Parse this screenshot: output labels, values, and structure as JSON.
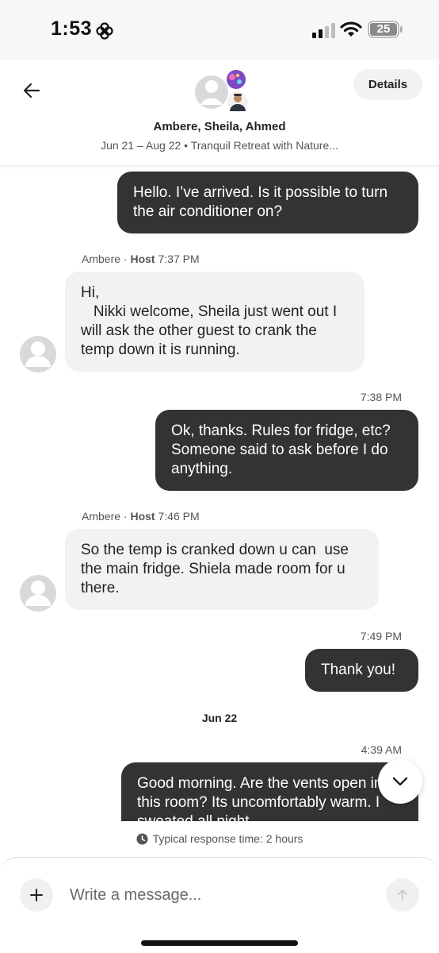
{
  "status_bar": {
    "time": "1:53",
    "battery": "25",
    "icons": [
      "focus-icon",
      "cellular-signal-icon",
      "wifi-icon",
      "battery-icon"
    ]
  },
  "header": {
    "participants": "Ambere, Sheila, Ahmed",
    "trip_info": "Jun 21 – Aug 22 • Tranquil Retreat with Nature...",
    "details_label": "Details",
    "icons": [
      "back-arrow-icon",
      "group-avatar"
    ]
  },
  "messages": [
    {
      "direction": "out",
      "text": "Hello. I’ve arrived. Is it possible to turn the air conditioner on?"
    },
    {
      "sender": "Ambere",
      "role": "Host",
      "time": "7:37 PM"
    },
    {
      "direction": "in",
      "text": "Hi,\n   Nikki welcome, Sheila just went out I will ask the other guest to crank the temp down it is running."
    },
    {
      "time": "7:38 PM"
    },
    {
      "direction": "out",
      "text": "Ok, thanks. Rules for fridge, etc? Someone said to ask before I do anything."
    },
    {
      "sender": "Ambere",
      "role": "Host",
      "time": "7:46 PM"
    },
    {
      "direction": "in",
      "text": "So the temp is cranked down u can  use the main fridge. Shiela made room for u there."
    },
    {
      "time": "7:49 PM"
    },
    {
      "direction": "out",
      "text": "Thank you!"
    },
    {
      "date": "Jun 22"
    },
    {
      "time": "4:39 AM"
    },
    {
      "direction": "out",
      "text": "Good morning. Are the vents open in this room? Its uncomfortably warm. I sweated all night."
    }
  ],
  "response_time": "Typical response time: 2 hours",
  "compose": {
    "placeholder": "Write a message...",
    "icons": [
      "plus-icon",
      "send-arrow-icon"
    ]
  },
  "colors": {
    "outgoing_bubble": "#333333",
    "incoming_bubble": "#f2f2f2",
    "text_primary": "#222222",
    "text_secondary": "#555555"
  }
}
